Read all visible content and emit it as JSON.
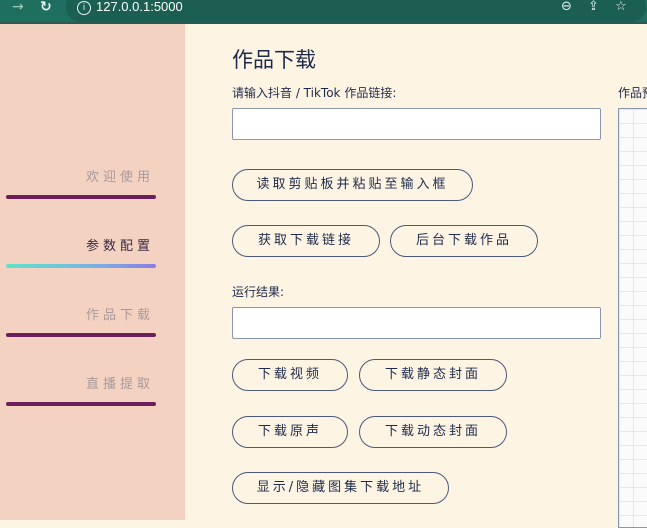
{
  "browser": {
    "url": "127.0.0.1:5000",
    "icons": [
      "back-arrow-icon",
      "reload-icon",
      "info-icon",
      "zoom-icon",
      "share-icon",
      "star-icon"
    ]
  },
  "sidebar": {
    "items": [
      {
        "label": "欢迎使用",
        "active": false
      },
      {
        "label": "参数配置",
        "active": true
      },
      {
        "label": "作品下载",
        "active": false
      },
      {
        "label": "直播提取",
        "active": false
      }
    ]
  },
  "main": {
    "title": "作品下载",
    "link_label": "请输入抖音 / TikTok 作品链接:",
    "link_value": "",
    "buttons": {
      "read_clipboard": "读取剪贴板并粘贴至输入框",
      "get_link": "获取下载链接",
      "background_download": "后台下载作品",
      "download_video": "下载视频",
      "download_static_cover": "下载静态封面",
      "download_audio": "下载原声",
      "download_dynamic_cover": "下载动态封面",
      "toggle_gallery": "显示/隐藏图集下载地址"
    },
    "result_label": "运行结果:",
    "result_value": "",
    "preview_label": "作品预览"
  },
  "colors": {
    "browser_bar": "#1f6f60",
    "sidebar_bg": "#f3d2c2",
    "main_bg": "#fdf4e4",
    "nav_line": "#6a1f5a",
    "active_gradient_start": "#5ee3c9",
    "active_gradient_end": "#8b7de3"
  }
}
